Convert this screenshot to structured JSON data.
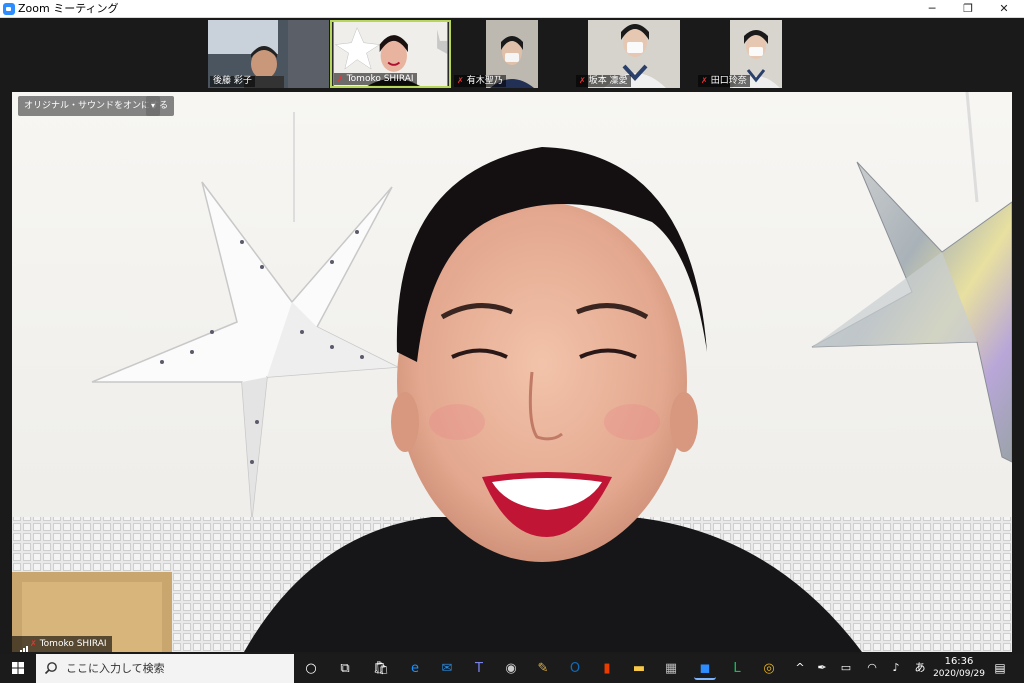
{
  "window": {
    "title": "Zoom ミーティング",
    "minimize": "─",
    "restore": "❐",
    "close": "✕"
  },
  "thumbnails": [
    {
      "name": "後藤 彩子",
      "muted": false,
      "active": false
    },
    {
      "name": "Tomoko SHIRAI",
      "muted": true,
      "active": true
    },
    {
      "name": "有木聖乃",
      "muted": true,
      "active": false
    },
    {
      "name": "坂本 凜愛",
      "muted": true,
      "active": false
    },
    {
      "name": "田口玲奈",
      "muted": true,
      "active": false
    }
  ],
  "main_video": {
    "sound_button": "オリジナル・サウンドをオンにする",
    "sound_dropdown": "▾",
    "speaker_name": "Tomoko SHIRAI"
  },
  "taskbar": {
    "search_placeholder": "ここに入力して検索",
    "ime_indicator": "あ",
    "time": "16:36",
    "date": "2020/09/29",
    "apps": [
      {
        "icon": "cortana-icon",
        "glyph": "○",
        "color": "#ffffff"
      },
      {
        "icon": "task-view-icon",
        "glyph": "⧉",
        "color": "#ffffff"
      },
      {
        "icon": "store-icon",
        "glyph": "🛍",
        "color": "#ffffff"
      },
      {
        "icon": "edge-icon",
        "glyph": "e",
        "color": "#1e90ff"
      },
      {
        "icon": "mail-icon",
        "glyph": "✉",
        "color": "#2b88d8"
      },
      {
        "icon": "teams-icon",
        "glyph": "T",
        "color": "#7b83eb"
      },
      {
        "icon": "camera-icon",
        "glyph": "◉",
        "color": "#cccccc"
      },
      {
        "icon": "paint-icon",
        "glyph": "✎",
        "color": "#e0b040"
      },
      {
        "icon": "outlook-icon",
        "glyph": "O",
        "color": "#0f6cbd"
      },
      {
        "icon": "office-icon",
        "glyph": "▮",
        "color": "#eb3c00"
      },
      {
        "icon": "explorer-icon",
        "glyph": "▬",
        "color": "#f8c948"
      },
      {
        "icon": "calculator-icon",
        "glyph": "▦",
        "color": "#bbbbbb"
      },
      {
        "icon": "zoom-icon",
        "glyph": "◼",
        "color": "#2d8cff"
      },
      {
        "icon": "line-icon",
        "glyph": "L",
        "color": "#06c755"
      },
      {
        "icon": "chrome-icon",
        "glyph": "◎",
        "color": "#e8b320"
      }
    ]
  }
}
